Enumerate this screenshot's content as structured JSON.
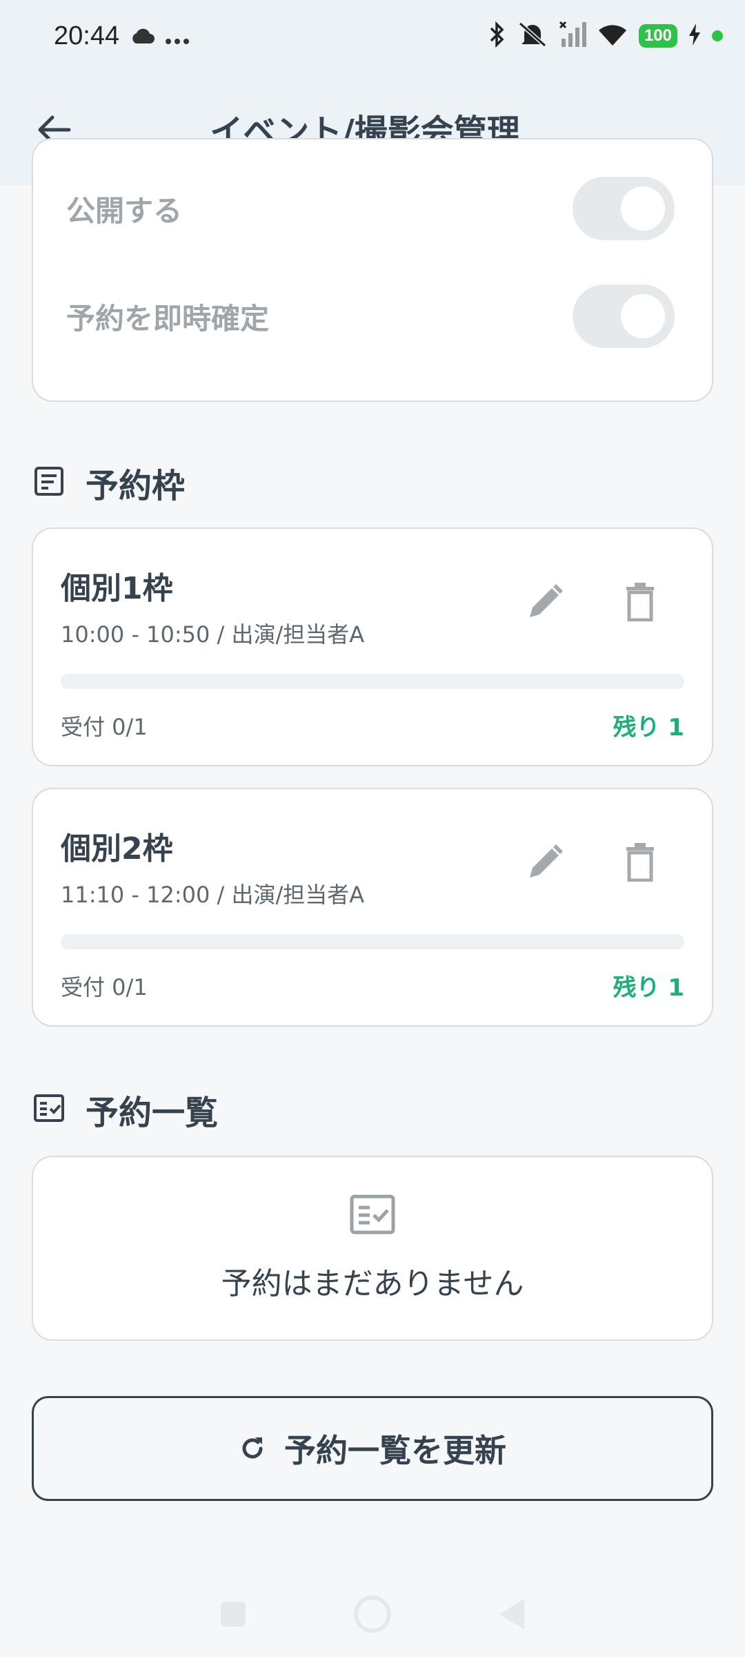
{
  "status_bar": {
    "time": "20:44",
    "battery": "100",
    "icons": [
      "cloud-icon",
      "more-dots-icon",
      "bluetooth-icon",
      "mute-icon",
      "signal-icon",
      "wifi-icon",
      "battery-icon",
      "charging-icon"
    ]
  },
  "appbar": {
    "title": "イベント/撮影会管理"
  },
  "settings": {
    "publish_label": "公開する",
    "instant_confirm_label": "予約を即時確定"
  },
  "slots_section": {
    "title": "予約枠",
    "slots": [
      {
        "name": "個別1枠",
        "time": "10:00 - 10:50 / 出演/担当者A",
        "accepted": "受付 0/1",
        "remaining": "残り 1",
        "fill_fraction": 0
      },
      {
        "name": "個別2枠",
        "time": "11:10 - 12:00 / 出演/担当者A",
        "accepted": "受付 0/1",
        "remaining": "残り 1",
        "fill_fraction": 0
      }
    ]
  },
  "reservations_section": {
    "title": "予約一覧",
    "empty_text": "予約はまだありません"
  },
  "refresh_button": {
    "label": "予約一覧を更新"
  },
  "colors": {
    "accent_green": "#1fae7a",
    "text_dark": "#36434f",
    "background": "#f5f7f9"
  }
}
